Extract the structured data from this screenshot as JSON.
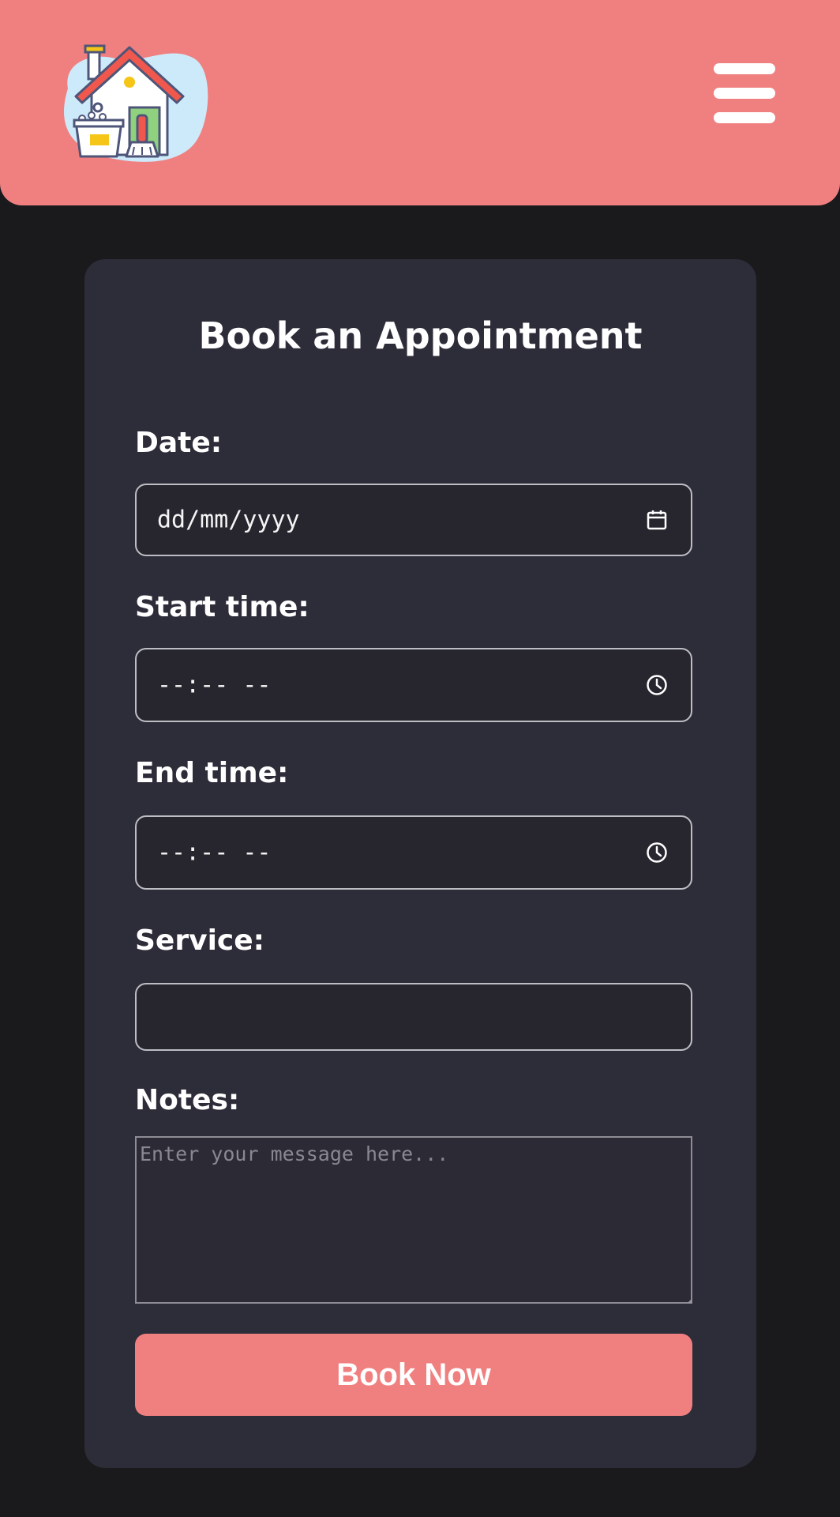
{
  "header": {
    "logo_icon": "house-cleaning-logo-icon",
    "menu_icon": "hamburger-menu-icon",
    "background_color": "#f08080"
  },
  "form": {
    "title": "Book an Appointment",
    "date": {
      "label": "Date:",
      "value": "dd/mm/yyyy",
      "icon": "calendar-icon"
    },
    "start_time": {
      "label": "Start time:",
      "value": "--:-- --",
      "icon": "clock-icon"
    },
    "end_time": {
      "label": "End time:",
      "value": "--:-- --",
      "icon": "clock-icon"
    },
    "service": {
      "label": "Service:",
      "value": ""
    },
    "notes": {
      "label": "Notes:",
      "value": "",
      "placeholder": "Enter your message here..."
    },
    "submit_label": "Book Now"
  },
  "colors": {
    "page_background": "#1a1a1c",
    "card_background": "#2d2c39",
    "accent": "#f08080",
    "text": "#ffffff"
  }
}
